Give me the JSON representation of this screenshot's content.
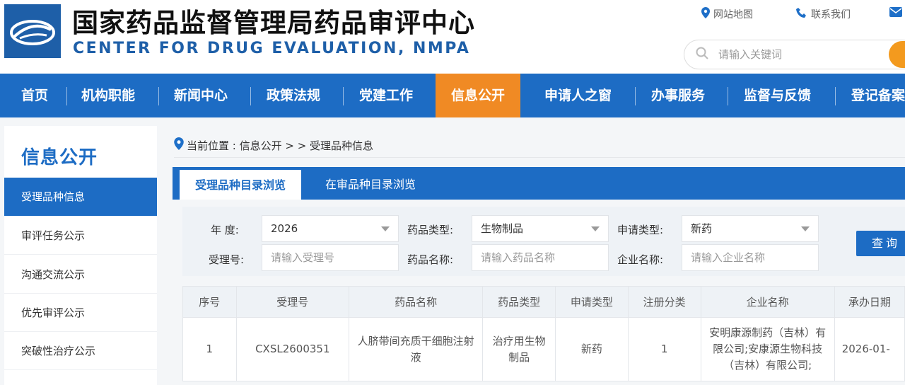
{
  "header": {
    "title_cn": "国家药品监督管理局药品审评中心",
    "title_en": "CENTER FOR DRUG EVALUATION, NMPA",
    "sitemap": "网站地图",
    "contact": "联系我们",
    "search_placeholder": "请输入关键词"
  },
  "nav": {
    "items": [
      {
        "label": "首页"
      },
      {
        "label": "机构职能"
      },
      {
        "label": "新闻中心"
      },
      {
        "label": "政策法规"
      },
      {
        "label": "党建工作"
      },
      {
        "label": "信息公开",
        "active": true
      },
      {
        "label": "申请人之窗"
      },
      {
        "label": "办事服务"
      },
      {
        "label": "监督与反馈"
      },
      {
        "label": "登记备案"
      }
    ]
  },
  "sidebar": {
    "title": "信息公开",
    "items": [
      {
        "label": "受理品种信息",
        "active": true
      },
      {
        "label": "审评任务公示"
      },
      {
        "label": "沟通交流公示"
      },
      {
        "label": "优先审评公示"
      },
      {
        "label": "突破性治疗公示"
      }
    ]
  },
  "breadcrumb": {
    "text": "当前位置 : 信息公开 > > 受理品种信息"
  },
  "tabs": [
    {
      "label": "受理品种目录浏览",
      "active": true
    },
    {
      "label": "在审品种目录浏览"
    }
  ],
  "filters": {
    "year_label": "年  度:",
    "year_value": "2026",
    "drug_type_label": "药品类型:",
    "drug_type_value": "生物制品",
    "apply_type_label": "申请类型:",
    "apply_type_value": "新药",
    "accept_no_label": "受理号:",
    "accept_no_placeholder": "请输入受理号",
    "drug_name_label": "药品名称:",
    "drug_name_placeholder": "请输入药品名称",
    "company_label": "企业名称:",
    "company_placeholder": "请输入企业名称",
    "query_button": "查询"
  },
  "table": {
    "headers": [
      "序号",
      "受理号",
      "药品名称",
      "药品类型",
      "申请类型",
      "注册分类",
      "企业名称",
      "承办日期"
    ],
    "rows": [
      [
        "1",
        "CXSL2600351",
        "人脐带间充质干细胞注射液",
        "治疗用生物制品",
        "新药",
        "1",
        "安明康源制药（吉林）有限公司;安康源生物科技（吉林）有限公司;",
        "2026-01-"
      ]
    ]
  },
  "colors": {
    "primary": "#1d6cc4",
    "accent": "#f08a24"
  }
}
